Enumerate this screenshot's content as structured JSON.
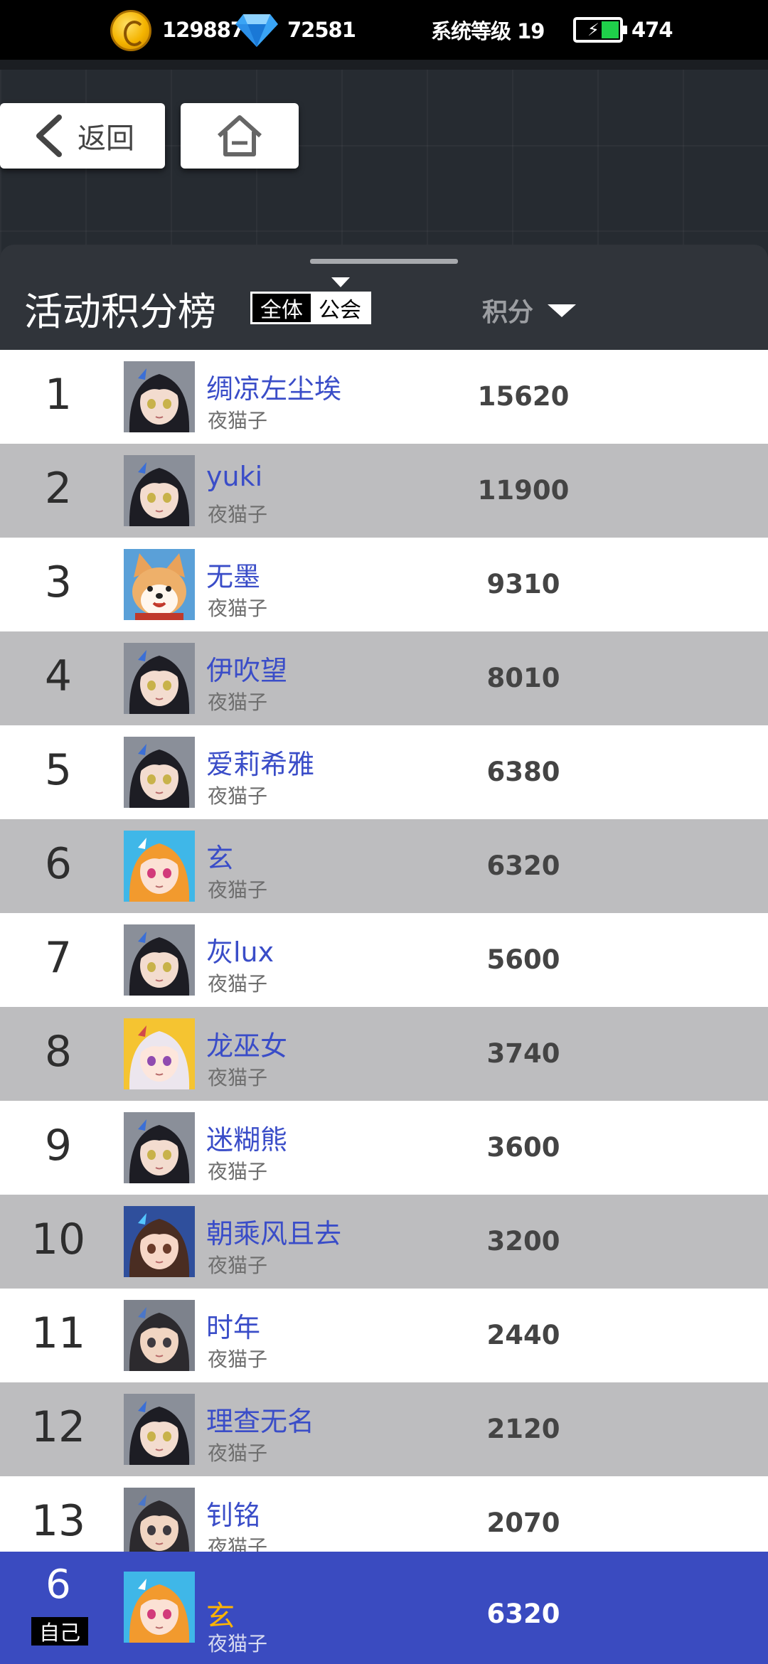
{
  "status": {
    "coins": "129887",
    "gems": "72581",
    "system_level": "系统等级 19",
    "energy": "474"
  },
  "nav": {
    "back_label": "返回"
  },
  "board": {
    "title": "活动积分榜",
    "filter_all": "全体",
    "filter_guild": "公会",
    "score_header": "积分"
  },
  "rows": [
    {
      "rank": "1",
      "name": "绸凉左尘埃",
      "guild": "夜猫子",
      "score": "15620",
      "avatar": "girl-black-hair"
    },
    {
      "rank": "2",
      "name": "yuki",
      "guild": "夜猫子",
      "score": "11900",
      "avatar": "girl-black-hair"
    },
    {
      "rank": "3",
      "name": "无墨",
      "guild": "夜猫子",
      "score": "9310",
      "avatar": "shiba-dog"
    },
    {
      "rank": "4",
      "name": "伊吹望",
      "guild": "夜猫子",
      "score": "8010",
      "avatar": "girl-black-hair"
    },
    {
      "rank": "5",
      "name": "爱莉希雅",
      "guild": "夜猫子",
      "score": "6380",
      "avatar": "girl-black-hair"
    },
    {
      "rank": "6",
      "name": "玄",
      "guild": "夜猫子",
      "score": "6320",
      "avatar": "girl-orange-hair"
    },
    {
      "rank": "7",
      "name": "灰lux",
      "guild": "夜猫子",
      "score": "5600",
      "avatar": "girl-black-hair"
    },
    {
      "rank": "8",
      "name": "龙巫女",
      "guild": "夜猫子",
      "score": "3740",
      "avatar": "girl-white-hair"
    },
    {
      "rank": "9",
      "name": "迷糊熊",
      "guild": "夜猫子",
      "score": "3600",
      "avatar": "girl-black-hair"
    },
    {
      "rank": "10",
      "name": "朝乘风且去",
      "guild": "夜猫子",
      "score": "3200",
      "avatar": "girl-fan"
    },
    {
      "rank": "11",
      "name": "时年",
      "guild": "夜猫子",
      "score": "2440",
      "avatar": "boy-dark-hair"
    },
    {
      "rank": "12",
      "name": "理查无名",
      "guild": "夜猫子",
      "score": "2120",
      "avatar": "girl-black-hair"
    },
    {
      "rank": "13",
      "name": "钊铭",
      "guild": "夜猫子",
      "score": "2070",
      "avatar": "boy-dark-hair"
    }
  ],
  "self": {
    "rank": "6",
    "badge": "自己",
    "name": "玄",
    "guild": "夜猫子",
    "score": "6320",
    "avatar": "girl-orange-hair"
  },
  "colors": {
    "name_blue": "#3a4dc8",
    "self_bar": "#3a4bc0",
    "self_name": "#ffb400",
    "row_gray": "#bdbdbf"
  }
}
